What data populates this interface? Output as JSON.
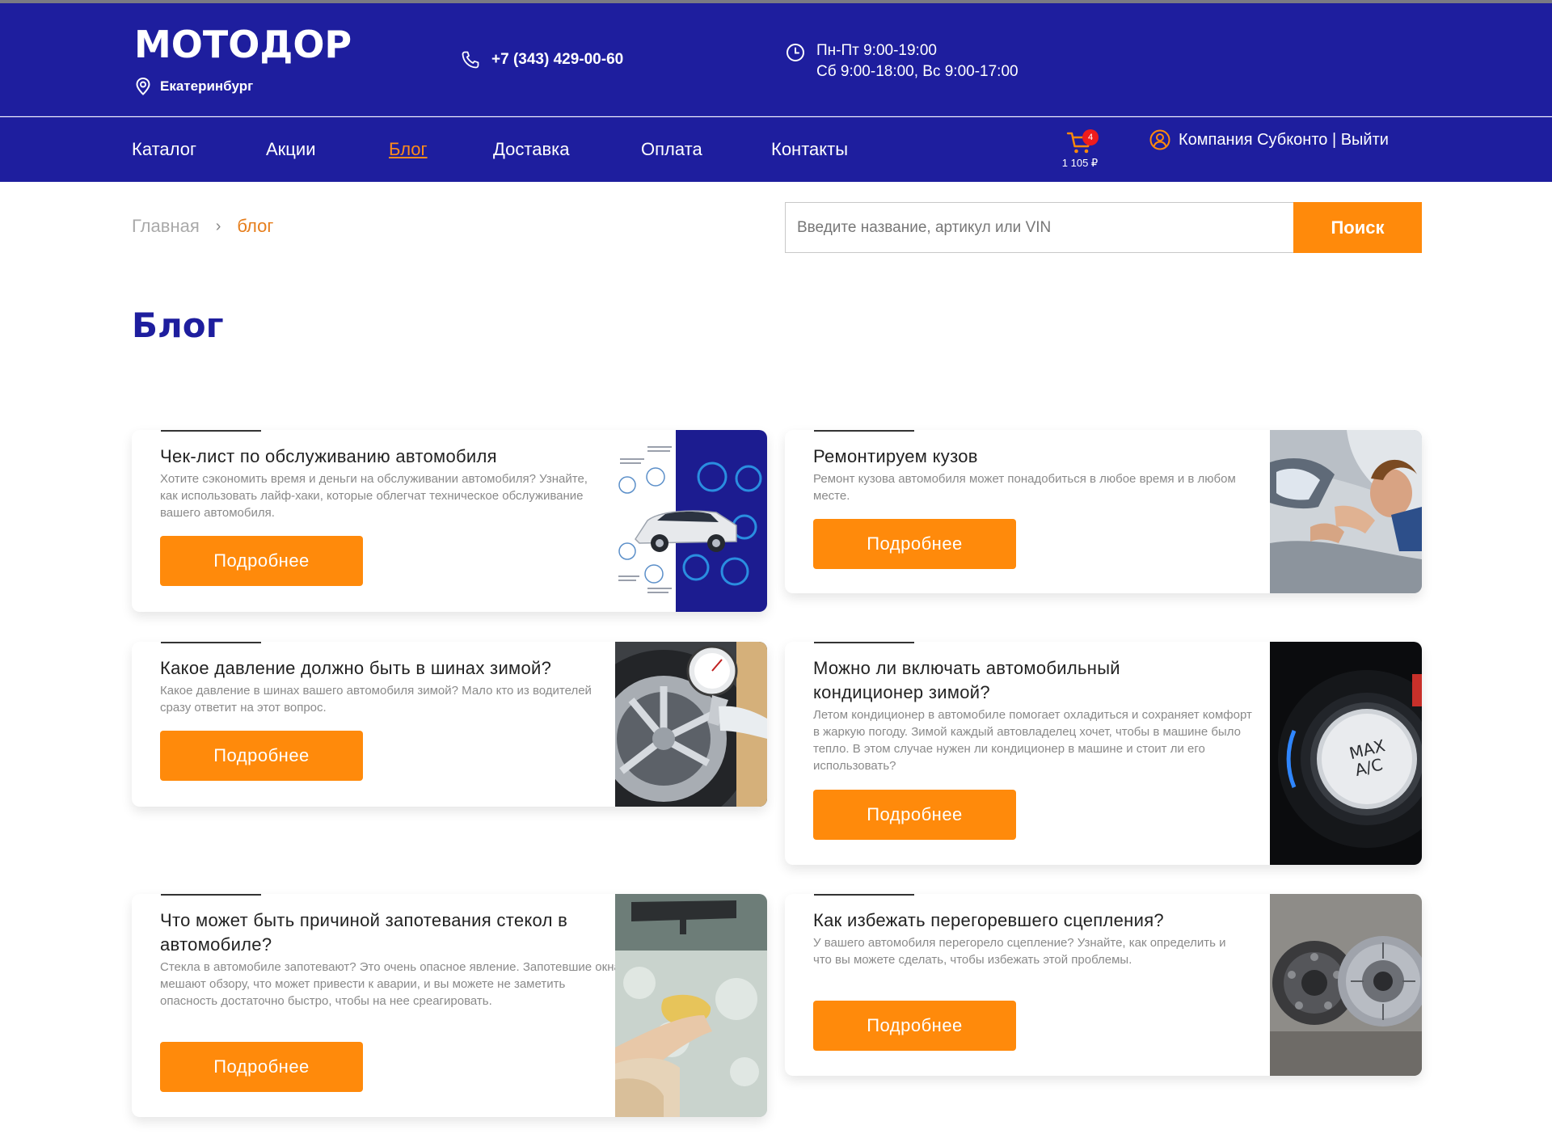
{
  "header": {
    "logo": "МОТОДОР",
    "city": "Екатеринбург",
    "phone": "+7 (343) 429-00-60",
    "hours_line1": "Пн-Пт 9:00-19:00",
    "hours_line2": "Сб 9:00-18:00, Вс 9:00-17:00"
  },
  "nav": {
    "items": [
      {
        "label": "Каталог"
      },
      {
        "label": "Акции"
      },
      {
        "label": "Блог"
      },
      {
        "label": "Доставка"
      },
      {
        "label": "Оплата"
      },
      {
        "label": "Контакты"
      }
    ],
    "active": "Блог",
    "cart": {
      "count": "4",
      "total": "1 105 ₽"
    },
    "account": {
      "company": "Компания Субконто",
      "separator": " | ",
      "logout": "Выйти"
    }
  },
  "breadcrumb": {
    "home": "Главная",
    "separator": "›",
    "current": "блог"
  },
  "search": {
    "placeholder": "Введите название, артикул или VIN",
    "button": "Поиск"
  },
  "page_title": "Блог",
  "cards": [
    {
      "title": "Чек-лист по обслуживанию автомобиля",
      "description": "Хотите сэкономить время и деньги на обслуживании автомобиля? Узнайте, как использовать лайф-хаки, которые облегчат техническое обслуживание вашего автомобиля.",
      "button": "Подробнее",
      "image": "car-maintenance-checklist-image"
    },
    {
      "title": "Ремонтируем кузов",
      "description": "Ремонт кузова автомобиля может понадобиться в любое время и в любом месте.",
      "button": "Подробнее",
      "image": "body-repair-image"
    },
    {
      "title": "Какое давление должно быть в шинах зимой?",
      "description": "Какое давление в шинах вашего автомобиля зимой? Мало кто из водителей сразу ответит на этот вопрос.",
      "button": "Подробнее",
      "image": "tire-pressure-gauge-image"
    },
    {
      "title": "Можно ли включать автомобильный кондиционер зимой?",
      "description": "Летом кондиционер в автомобиле помогает охладиться и сохраняет комфорт в жаркую погоду. Зимой каждый автовладелец хочет, чтобы в машине было тепло. В этом случае нужен ли кондиционер в машине и стоит ли его использовать?",
      "button": "Подробнее",
      "image": "max-ac-knob-image",
      "image_label": "MAX A/C"
    },
    {
      "title": "Что может быть причиной запотевания стекол в автомобиле?",
      "description": "Стекла в автомобиле запотевают? Это очень опасное явление. Запотевшие окна мешают обзору, что может привести к аварии, и вы можете не заметить опасность достаточно быстро, чтобы на нее среагировать.",
      "button": "Подробнее",
      "image": "foggy-windshield-image"
    },
    {
      "title": "Как избежать перегоревшего сцепления?",
      "description": "У вашего автомобиля перегорело сцепление? Узнайте, как определить и что вы можете сделать, чтобы избежать этой проблемы.",
      "button": "Подробнее",
      "image": "clutch-disc-image"
    }
  ],
  "colors": {
    "brand_blue": "#1e1e9e",
    "accent_orange": "#ff8a0b",
    "active_nav": "#ff8c1a",
    "badge_red": "#ee1c1c"
  }
}
